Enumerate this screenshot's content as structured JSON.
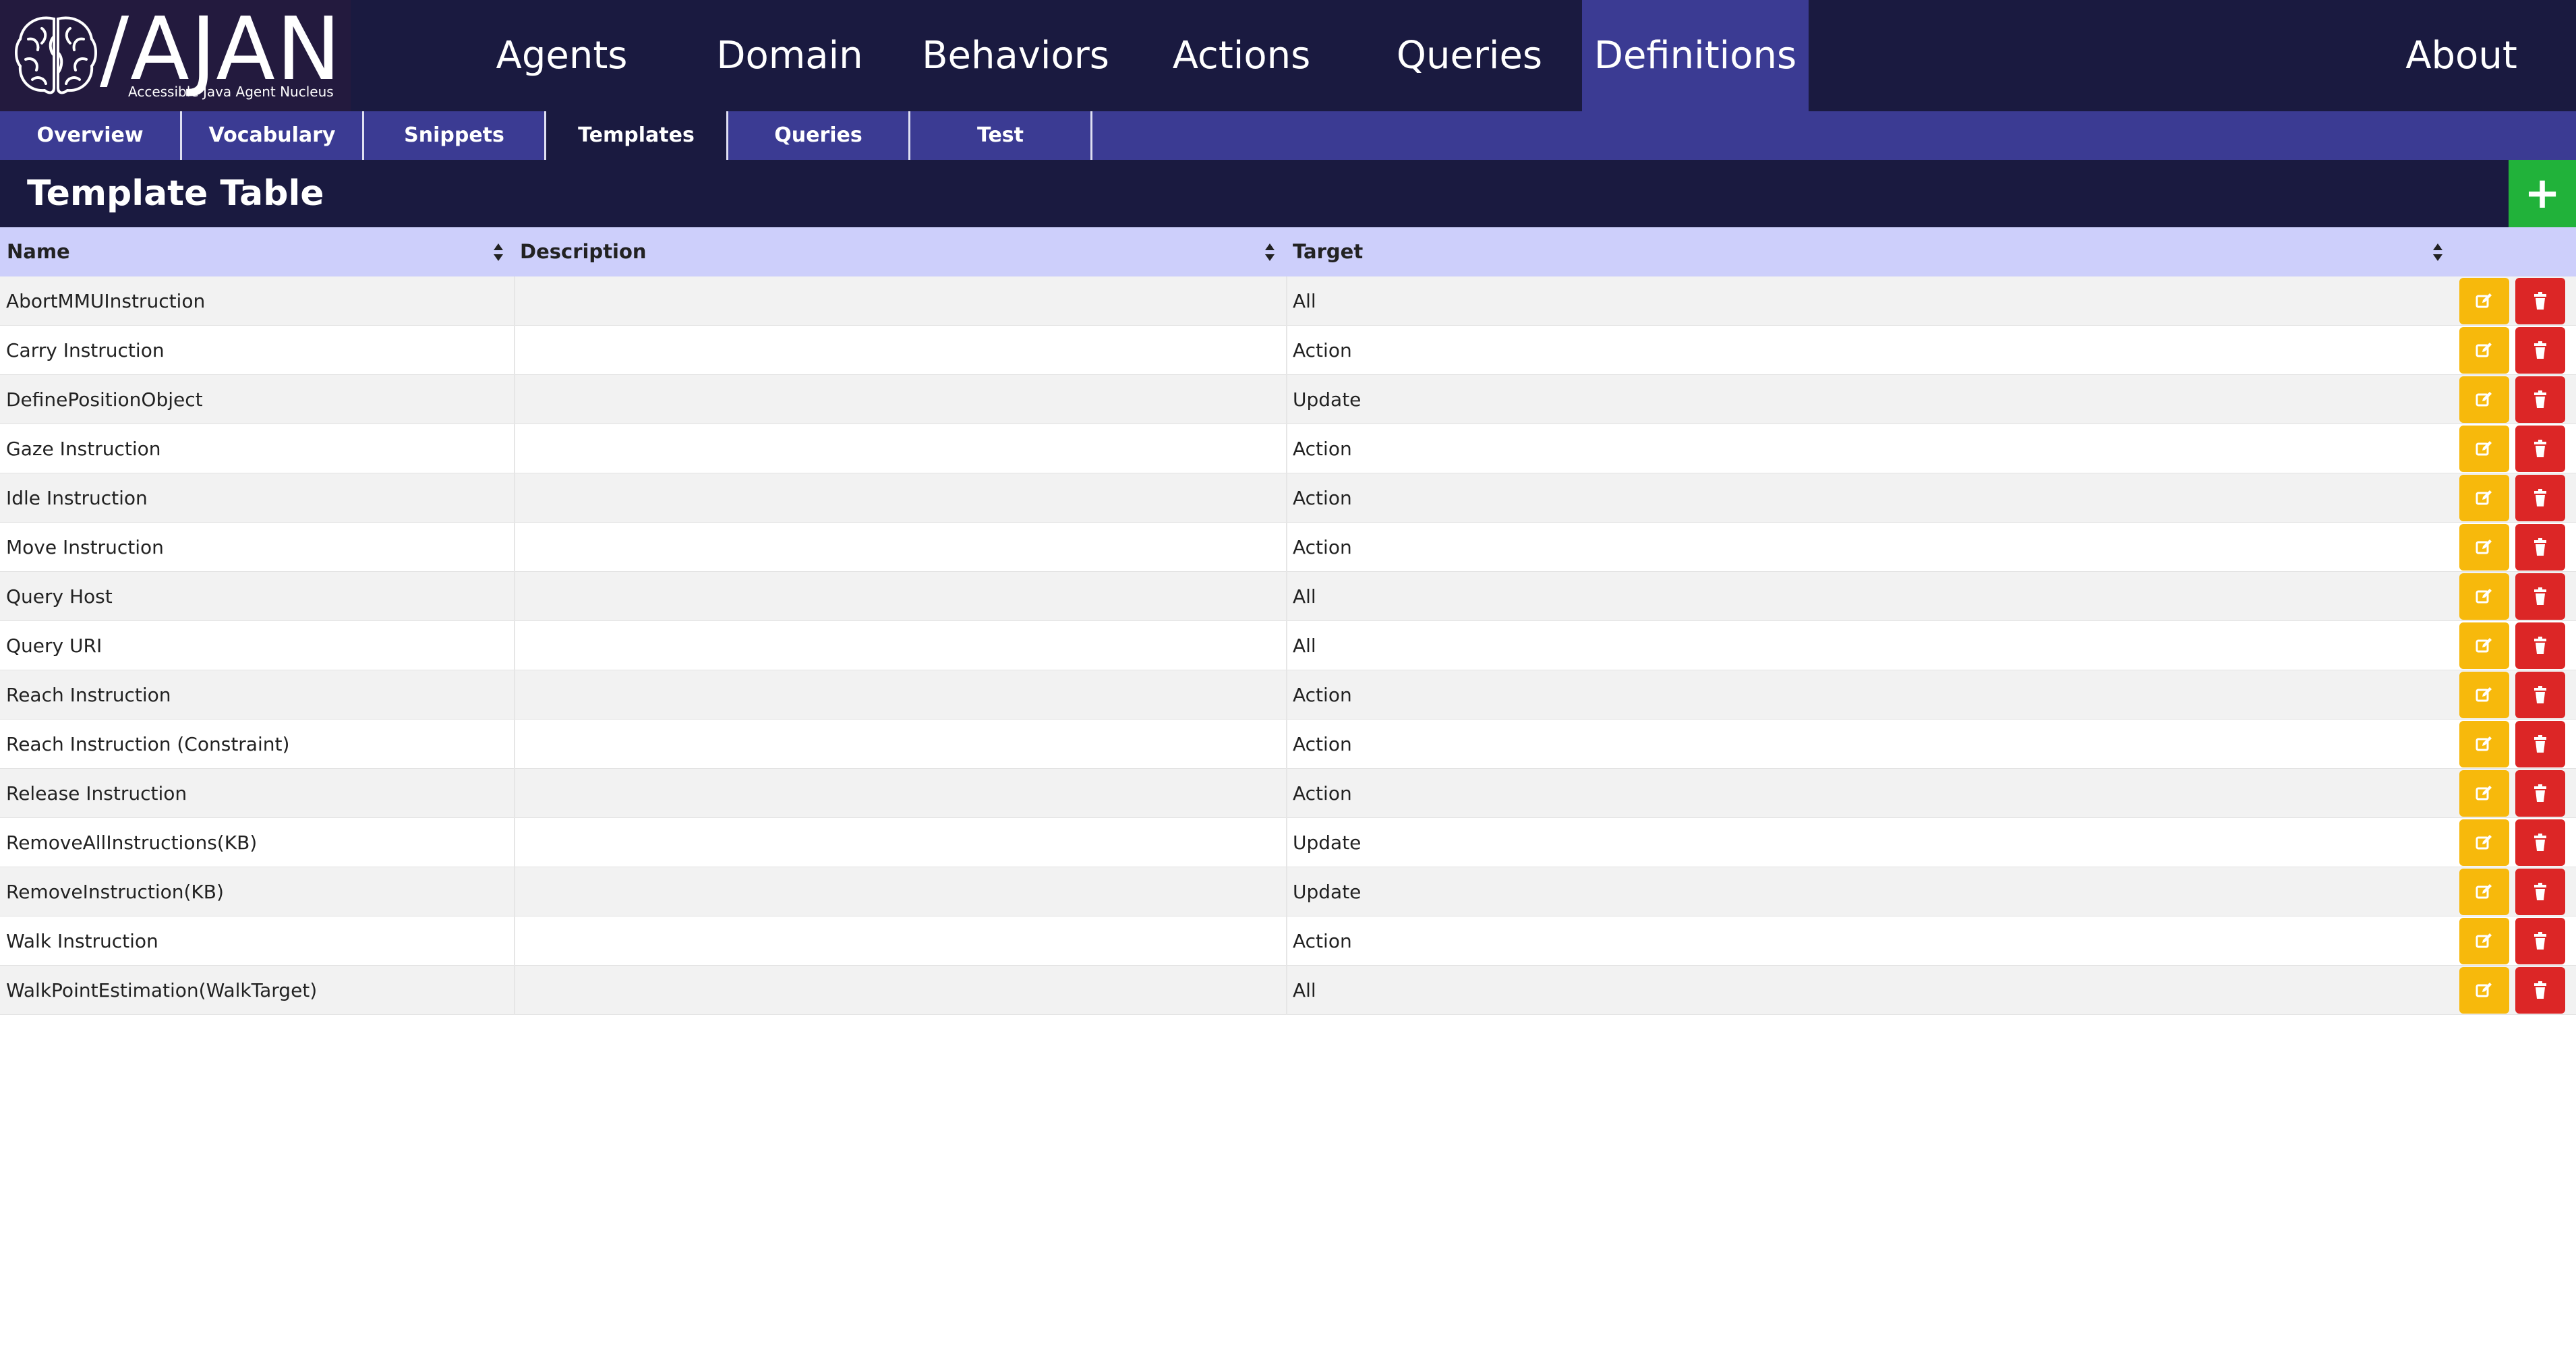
{
  "app": {
    "logo_title": "/AJAN",
    "logo_subtitle": "Accessible Java Agent Nucleus"
  },
  "nav": {
    "items": [
      "Agents",
      "Domain",
      "Behaviors",
      "Actions",
      "Queries",
      "Definitions"
    ],
    "active": "Definitions",
    "about": "About"
  },
  "subnav": {
    "items": [
      "Overview",
      "Vocabulary",
      "Snippets",
      "Templates",
      "Queries",
      "Test"
    ],
    "active": "Templates"
  },
  "table": {
    "title": "Template Table",
    "add_label": "+",
    "columns": [
      "Name",
      "Description",
      "Target"
    ],
    "rows": [
      {
        "name": "AbortMMUInstruction",
        "description": "",
        "target": "All"
      },
      {
        "name": "Carry Instruction",
        "description": "",
        "target": "Action"
      },
      {
        "name": "DefinePositionObject",
        "description": "",
        "target": "Update"
      },
      {
        "name": "Gaze Instruction",
        "description": "",
        "target": "Action"
      },
      {
        "name": "Idle Instruction",
        "description": "",
        "target": "Action"
      },
      {
        "name": "Move Instruction",
        "description": "",
        "target": "Action"
      },
      {
        "name": "Query Host",
        "description": "",
        "target": "All"
      },
      {
        "name": "Query URI",
        "description": "",
        "target": "All"
      },
      {
        "name": "Reach Instruction",
        "description": "",
        "target": "Action"
      },
      {
        "name": "Reach Instruction (Constraint)",
        "description": "",
        "target": "Action"
      },
      {
        "name": "Release Instruction",
        "description": "",
        "target": "Action"
      },
      {
        "name": "RemoveAllInstructions(KB)",
        "description": "",
        "target": "Update"
      },
      {
        "name": "RemoveInstruction(KB)",
        "description": "",
        "target": "Update"
      },
      {
        "name": "Walk Instruction",
        "description": "",
        "target": "Action"
      },
      {
        "name": "WalkPointEstimation(WalkTarget)",
        "description": "",
        "target": "All"
      }
    ],
    "row_actions": {
      "edit_icon": "edit-icon",
      "delete_icon": "trash-icon"
    }
  },
  "colors": {
    "nav_bg": "#1a1a40",
    "accent": "#3b3b93",
    "header_row": "#cdcffb",
    "add_button": "#21b23a",
    "edit_button": "#f7b90c",
    "delete_button": "#dc2626"
  }
}
